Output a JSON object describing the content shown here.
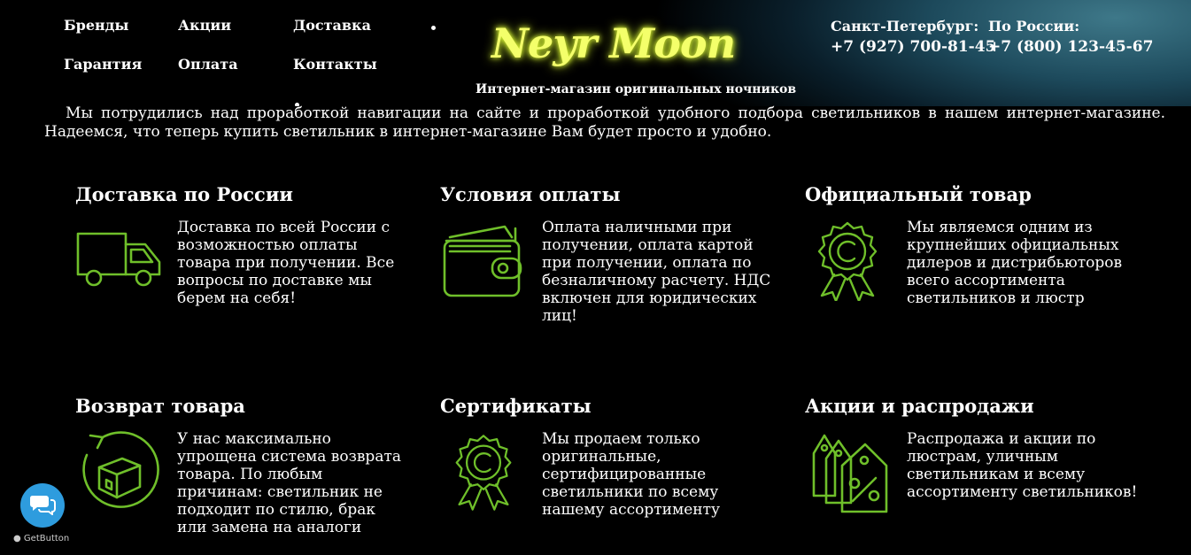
{
  "header": {
    "nav": [
      "Бренды",
      "Акции",
      "Доставка",
      "Гарантия",
      "Оплата",
      "Контакты"
    ],
    "logo_text": "Neyr Moon",
    "tagline": "Интернет-магазин оригинальных ночников",
    "phones": [
      {
        "label": "Санкт-Петербург:",
        "number": "+7 (927) 700-81-45"
      },
      {
        "label": "По России:",
        "number": "+7 (800) 123-45-67"
      }
    ]
  },
  "intro": "Мы потрудились над проработкой навигации на сайте и проработкой удобного подбора светильников в нашем интернет-магазине. Надеемся, что теперь купить светильник в интернет-магазине Вам будет просто и удобно.",
  "features": [
    {
      "title": "Доставка по России",
      "text": "Доставка по всей России с возможностью оплаты товара при получении. Все вопросы по доставке мы берем на себя!",
      "icon": "truck-icon"
    },
    {
      "title": "Условия оплаты",
      "text": "Оплата наличными при получении, оплата картой при получении, оплата по безналичному расчету. НДС включен для юридических лиц!",
      "icon": "wallet-icon"
    },
    {
      "title": "Официальный товар",
      "text": "Мы являемся одним из крупнейших официальных дилеров и дистрибьюторов всего ассортимента светильников и люстр",
      "icon": "award-badge-icon"
    },
    {
      "title": "Возврат товара",
      "text": "У нас максимально упрощена система возврата товара. По любым причинам: светильник не подходит по стилю, брак или замена на аналоги",
      "icon": "return-box-icon"
    },
    {
      "title": "Сертификаты",
      "text": "Мы продаем только оригинальные, сертифицированные светильники по всему нашему ассортименту",
      "icon": "certificate-icon"
    },
    {
      "title": "Акции и распродажи",
      "text": "Распродажа и акции по люстрам, уличным светильникам и всему ассортименту светильников!",
      "icon": "discount-tags-icon"
    }
  ],
  "getbutton": {
    "label": "GetButton",
    "icon": "chat-bubbles-icon"
  },
  "colors": {
    "icon_green": "#6fbf2a",
    "logo_yellow": "#f4ff6a",
    "getbutton_blue": "#2e9cde"
  }
}
